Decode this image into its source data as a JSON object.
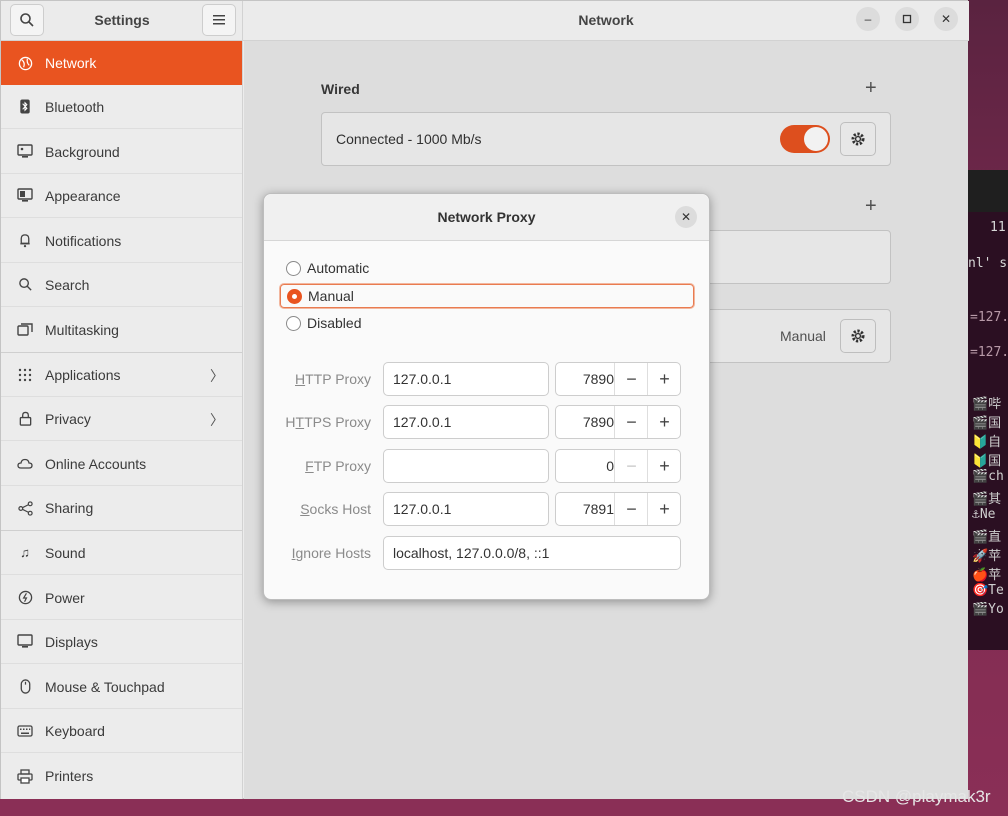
{
  "header": {
    "sidebar_title": "Settings",
    "main_title": "Network"
  },
  "sidebar": {
    "items": [
      {
        "label": "Network",
        "icon": "globe-icon"
      },
      {
        "label": "Bluetooth",
        "icon": "bluetooth-icon"
      },
      {
        "label": "Background",
        "icon": "monitor-icon"
      },
      {
        "label": "Appearance",
        "icon": "appearance-icon"
      },
      {
        "label": "Notifications",
        "icon": "bell-icon"
      },
      {
        "label": "Search",
        "icon": "search-icon"
      },
      {
        "label": "Multitasking",
        "icon": "multitasking-icon"
      },
      {
        "label": "Applications",
        "icon": "grid-icon"
      },
      {
        "label": "Privacy",
        "icon": "lock-icon"
      },
      {
        "label": "Online Accounts",
        "icon": "cloud-icon"
      },
      {
        "label": "Sharing",
        "icon": "share-icon"
      },
      {
        "label": "Sound",
        "icon": "music-note-icon"
      },
      {
        "label": "Power",
        "icon": "power-icon"
      },
      {
        "label": "Displays",
        "icon": "display-icon"
      },
      {
        "label": "Mouse & Touchpad",
        "icon": "mouse-icon"
      },
      {
        "label": "Keyboard",
        "icon": "keyboard-icon"
      },
      {
        "label": "Printers",
        "icon": "printer-icon"
      }
    ]
  },
  "main": {
    "wired_title": "Wired",
    "wired_status": "Connected - 1000 Mb/s",
    "proxy_value": "Manual"
  },
  "dialog": {
    "title": "Network Proxy",
    "radios": {
      "automatic": "Automatic",
      "manual": "Manual",
      "disabled": "Disabled"
    },
    "http": {
      "label_first": "H",
      "label_rest": "TTP Proxy",
      "host": "127.0.0.1",
      "port": "7890"
    },
    "https": {
      "label_pre": "H",
      "label_u": "T",
      "label_rest": "TPS Proxy",
      "host": "127.0.0.1",
      "port": "7890"
    },
    "ftp": {
      "label_first": "F",
      "label_rest": "TP Proxy",
      "host": "",
      "port": "0"
    },
    "socks": {
      "label_first": "S",
      "label_rest": "ocks Host",
      "host": "127.0.0.1",
      "port": "7891"
    },
    "ignore": {
      "label_first": "I",
      "label_rest": "gnore Hosts",
      "value": "localhost, 127.0.0.0/8, ::1"
    }
  },
  "background": {
    "term_line1": "11",
    "term_line2": "nl' s",
    "term_line3": "=127.",
    "term_line4": "=127.",
    "icon_lines": [
      "🎬哔",
      "🎬国",
      "🔰自",
      "🔰国",
      "🎬ch",
      "🎬其",
      "⚓Ne",
      "🎬直",
      "🚀苹",
      "🍎苹",
      "🎯Te",
      "🎬Yo"
    ]
  },
  "watermark": "CSDN @playmak3r",
  "colors": {
    "accent": "#e95420"
  }
}
